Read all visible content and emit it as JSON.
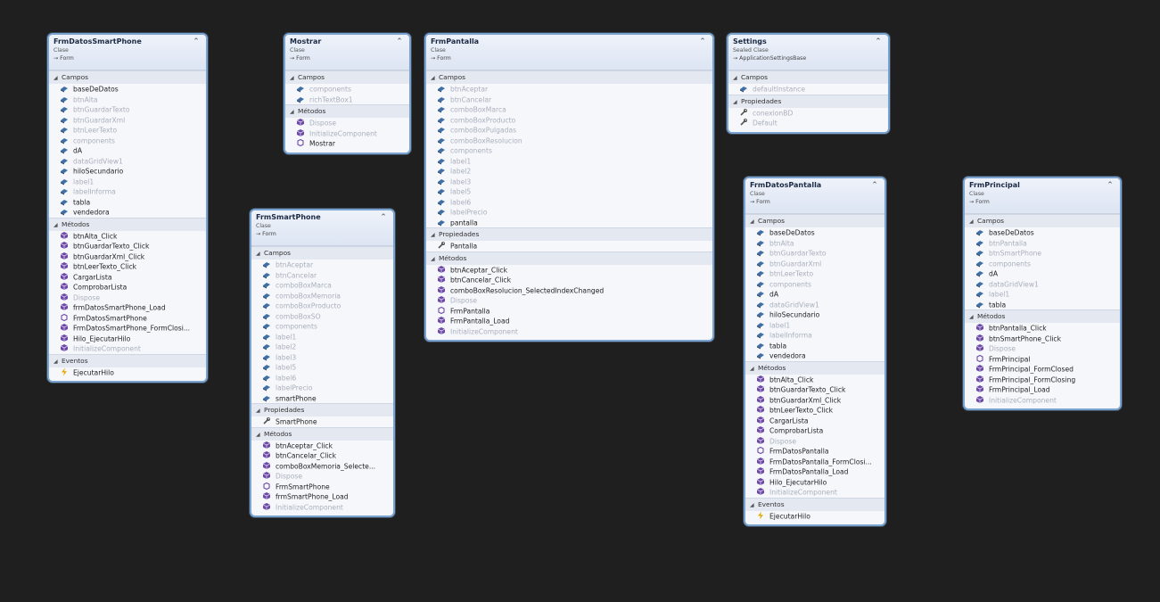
{
  "colors": {
    "background": "#1f1f1f",
    "field_icon": "#3f6fa5",
    "method_icon": "#6d4aa8",
    "property_icon": "#555555",
    "event_icon": "#e0a800",
    "dim_text": "#a8afbc"
  },
  "classes": [
    {
      "id": "FrmDatosSmartPhone",
      "name": "FrmDatosSmartPhone",
      "stereotype": "Clase",
      "inherits": "Form",
      "sections": [
        {
          "title": "Campos",
          "members": [
            {
              "label": "baseDeDatos",
              "icon": "field-icon",
              "dim": false
            },
            {
              "label": "btnAlta",
              "icon": "field-icon",
              "dim": true
            },
            {
              "label": "btnGuardarTexto",
              "icon": "field-icon",
              "dim": true
            },
            {
              "label": "btnGuardarXml",
              "icon": "field-icon",
              "dim": true
            },
            {
              "label": "btnLeerTexto",
              "icon": "field-icon",
              "dim": true
            },
            {
              "label": "components",
              "icon": "field-icon",
              "dim": true
            },
            {
              "label": "dA",
              "icon": "field-icon",
              "dim": false
            },
            {
              "label": "dataGridView1",
              "icon": "field-icon",
              "dim": true
            },
            {
              "label": "hiloSecundario",
              "icon": "field-icon",
              "dim": false
            },
            {
              "label": "label1",
              "icon": "field-icon",
              "dim": true
            },
            {
              "label": "labelInforma",
              "icon": "field-icon",
              "dim": true
            },
            {
              "label": "tabla",
              "icon": "field-icon",
              "dim": false
            },
            {
              "label": "vendedora",
              "icon": "field-icon",
              "dim": false
            }
          ]
        },
        {
          "title": "Métodos",
          "members": [
            {
              "label": "btnAlta_Click",
              "icon": "method-icon",
              "dim": false
            },
            {
              "label": "btnGuardarTexto_Click",
              "icon": "method-icon",
              "dim": false
            },
            {
              "label": "btnGuardarXml_Click",
              "icon": "method-icon",
              "dim": false
            },
            {
              "label": "btnLeerTexto_Click",
              "icon": "method-icon",
              "dim": false
            },
            {
              "label": "CargarLista",
              "icon": "method-icon",
              "dim": false
            },
            {
              "label": "ComprobarLista",
              "icon": "method-icon",
              "dim": false
            },
            {
              "label": "Dispose",
              "icon": "method-icon",
              "dim": true
            },
            {
              "label": "frmDatosSmartPhone_Load",
              "icon": "method-icon",
              "dim": false
            },
            {
              "label": "FrmDatosSmartPhone",
              "icon": "constructor-icon",
              "dim": false
            },
            {
              "label": "FrmDatosSmartPhone_FormClosi...",
              "icon": "method-icon",
              "dim": false
            },
            {
              "label": "Hilo_EjecutarHilo",
              "icon": "method-icon",
              "dim": false
            },
            {
              "label": "InitializeComponent",
              "icon": "method-icon",
              "dim": true
            }
          ]
        },
        {
          "title": "Eventos",
          "members": [
            {
              "label": "EjecutarHilo",
              "icon": "event-icon",
              "dim": false
            }
          ]
        }
      ]
    },
    {
      "id": "Mostrar",
      "name": "Mostrar",
      "stereotype": "Clase",
      "inherits": "Form",
      "sections": [
        {
          "title": "Campos",
          "members": [
            {
              "label": "components",
              "icon": "field-icon",
              "dim": true
            },
            {
              "label": "richTextBox1",
              "icon": "field-icon",
              "dim": true
            }
          ]
        },
        {
          "title": "Métodos",
          "members": [
            {
              "label": "Dispose",
              "icon": "method-icon",
              "dim": true
            },
            {
              "label": "InitializeComponent",
              "icon": "method-icon",
              "dim": true
            },
            {
              "label": "Mostrar",
              "icon": "constructor-icon",
              "dim": false
            }
          ]
        }
      ]
    },
    {
      "id": "FrmSmartPhone",
      "name": "FrmSmartPhone",
      "stereotype": "Clase",
      "inherits": "Form",
      "sections": [
        {
          "title": "Campos",
          "members": [
            {
              "label": "btnAceptar",
              "icon": "field-icon",
              "dim": true
            },
            {
              "label": "btnCancelar",
              "icon": "field-icon",
              "dim": true
            },
            {
              "label": "comboBoxMarca",
              "icon": "field-icon",
              "dim": true
            },
            {
              "label": "comboBoxMemoria",
              "icon": "field-icon",
              "dim": true
            },
            {
              "label": "comboBoxProducto",
              "icon": "field-icon",
              "dim": true
            },
            {
              "label": "comboBoxSO",
              "icon": "field-icon",
              "dim": true
            },
            {
              "label": "components",
              "icon": "field-icon",
              "dim": true
            },
            {
              "label": "label1",
              "icon": "field-icon",
              "dim": true
            },
            {
              "label": "label2",
              "icon": "field-icon",
              "dim": true
            },
            {
              "label": "label3",
              "icon": "field-icon",
              "dim": true
            },
            {
              "label": "label5",
              "icon": "field-icon",
              "dim": true
            },
            {
              "label": "label6",
              "icon": "field-icon",
              "dim": true
            },
            {
              "label": "labelPrecio",
              "icon": "field-icon",
              "dim": true
            },
            {
              "label": "smartPhone",
              "icon": "field-icon",
              "dim": false
            }
          ]
        },
        {
          "title": "Propiedades",
          "members": [
            {
              "label": "SmartPhone",
              "icon": "property-icon",
              "dim": false
            }
          ]
        },
        {
          "title": "Métodos",
          "members": [
            {
              "label": "btnAceptar_Click",
              "icon": "method-icon",
              "dim": false
            },
            {
              "label": "btnCancelar_Click",
              "icon": "method-icon",
              "dim": false
            },
            {
              "label": "comboBoxMemoria_Selecte...",
              "icon": "method-icon",
              "dim": false
            },
            {
              "label": "Dispose",
              "icon": "method-icon",
              "dim": true
            },
            {
              "label": "FrmSmartPhone",
              "icon": "constructor-icon",
              "dim": false
            },
            {
              "label": "frmSmartPhone_Load",
              "icon": "method-icon",
              "dim": false
            },
            {
              "label": "InitializeComponent",
              "icon": "method-icon",
              "dim": true
            }
          ]
        }
      ]
    },
    {
      "id": "FrmPantalla",
      "name": "FrmPantalla",
      "stereotype": "Clase",
      "inherits": "Form",
      "sections": [
        {
          "title": "Campos",
          "members": [
            {
              "label": "btnAceptar",
              "icon": "field-icon",
              "dim": true
            },
            {
              "label": "btnCancelar",
              "icon": "field-icon",
              "dim": true
            },
            {
              "label": "comboBoxMarca",
              "icon": "field-icon",
              "dim": true
            },
            {
              "label": "comboBoxProducto",
              "icon": "field-icon",
              "dim": true
            },
            {
              "label": "comboBoxPulgadas",
              "icon": "field-icon",
              "dim": true
            },
            {
              "label": "comboBoxResolucion",
              "icon": "field-icon",
              "dim": true
            },
            {
              "label": "components",
              "icon": "field-icon",
              "dim": true
            },
            {
              "label": "label1",
              "icon": "field-icon",
              "dim": true
            },
            {
              "label": "label2",
              "icon": "field-icon",
              "dim": true
            },
            {
              "label": "label3",
              "icon": "field-icon",
              "dim": true
            },
            {
              "label": "label5",
              "icon": "field-icon",
              "dim": true
            },
            {
              "label": "label6",
              "icon": "field-icon",
              "dim": true
            },
            {
              "label": "labelPrecio",
              "icon": "field-icon",
              "dim": true
            },
            {
              "label": "pantalla",
              "icon": "field-icon",
              "dim": false
            }
          ]
        },
        {
          "title": "Propiedades",
          "members": [
            {
              "label": "Pantalla",
              "icon": "property-icon",
              "dim": false
            }
          ]
        },
        {
          "title": "Métodos",
          "members": [
            {
              "label": "btnAceptar_Click",
              "icon": "method-icon",
              "dim": false
            },
            {
              "label": "btnCancelar_Click",
              "icon": "method-icon",
              "dim": false
            },
            {
              "label": "comboBoxResolucion_SelectedIndexChanged",
              "icon": "method-icon",
              "dim": false
            },
            {
              "label": "Dispose",
              "icon": "method-icon",
              "dim": true
            },
            {
              "label": "FrmPantalla",
              "icon": "constructor-icon",
              "dim": false
            },
            {
              "label": "FrmPantalla_Load",
              "icon": "method-icon",
              "dim": false
            },
            {
              "label": "InitializeComponent",
              "icon": "method-icon",
              "dim": true
            }
          ]
        }
      ]
    },
    {
      "id": "Settings",
      "name": "Settings",
      "stereotype": "Sealed Clase",
      "inherits": "ApplicationSettingsBase",
      "sections": [
        {
          "title": "Campos",
          "members": [
            {
              "label": "defaultInstance",
              "icon": "field-icon",
              "dim": true
            }
          ]
        },
        {
          "title": "Propiedades",
          "members": [
            {
              "label": "conexionBD",
              "icon": "property-icon",
              "dim": true
            },
            {
              "label": "Default",
              "icon": "property-icon",
              "dim": true
            }
          ]
        }
      ]
    },
    {
      "id": "FrmDatosPantalla",
      "name": "FrmDatosPantalla",
      "stereotype": "Clase",
      "inherits": "Form",
      "sections": [
        {
          "title": "Campos",
          "members": [
            {
              "label": "baseDeDatos",
              "icon": "field-icon",
              "dim": false
            },
            {
              "label": "btnAlta",
              "icon": "field-icon",
              "dim": true
            },
            {
              "label": "btnGuardarTexto",
              "icon": "field-icon",
              "dim": true
            },
            {
              "label": "btnGuardarXml",
              "icon": "field-icon",
              "dim": true
            },
            {
              "label": "btnLeerTexto",
              "icon": "field-icon",
              "dim": true
            },
            {
              "label": "components",
              "icon": "field-icon",
              "dim": true
            },
            {
              "label": "dA",
              "icon": "field-icon",
              "dim": false
            },
            {
              "label": "dataGridView1",
              "icon": "field-icon",
              "dim": true
            },
            {
              "label": "hiloSecundario",
              "icon": "field-icon",
              "dim": false
            },
            {
              "label": "label1",
              "icon": "field-icon",
              "dim": true
            },
            {
              "label": "labelInforma",
              "icon": "field-icon",
              "dim": true
            },
            {
              "label": "tabla",
              "icon": "field-icon",
              "dim": false
            },
            {
              "label": "vendedora",
              "icon": "field-icon",
              "dim": false
            }
          ]
        },
        {
          "title": "Métodos",
          "members": [
            {
              "label": "btnAlta_Click",
              "icon": "method-icon",
              "dim": false
            },
            {
              "label": "btnGuardarTexto_Click",
              "icon": "method-icon",
              "dim": false
            },
            {
              "label": "btnGuardarXml_Click",
              "icon": "method-icon",
              "dim": false
            },
            {
              "label": "btnLeerTexto_Click",
              "icon": "method-icon",
              "dim": false
            },
            {
              "label": "CargarLista",
              "icon": "method-icon",
              "dim": false
            },
            {
              "label": "ComprobarLista",
              "icon": "method-icon",
              "dim": false
            },
            {
              "label": "Dispose",
              "icon": "method-icon",
              "dim": true
            },
            {
              "label": "FrmDatosPantalla",
              "icon": "constructor-icon",
              "dim": false
            },
            {
              "label": "FrmDatosPantalla_FormClosi...",
              "icon": "method-icon",
              "dim": false
            },
            {
              "label": "FrmDatosPantalla_Load",
              "icon": "method-icon",
              "dim": false
            },
            {
              "label": "Hilo_EjecutarHilo",
              "icon": "method-icon",
              "dim": false
            },
            {
              "label": "InitializeComponent",
              "icon": "method-icon",
              "dim": true
            }
          ]
        },
        {
          "title": "Eventos",
          "members": [
            {
              "label": "EjecutarHilo",
              "icon": "event-icon",
              "dim": false
            }
          ]
        }
      ]
    },
    {
      "id": "FrmPrincipal",
      "name": "FrmPrincipal",
      "stereotype": "Clase",
      "inherits": "Form",
      "sections": [
        {
          "title": "Campos",
          "members": [
            {
              "label": "baseDeDatos",
              "icon": "field-icon",
              "dim": false
            },
            {
              "label": "btnPantalla",
              "icon": "field-icon",
              "dim": true
            },
            {
              "label": "btnSmartPhone",
              "icon": "field-icon",
              "dim": true
            },
            {
              "label": "components",
              "icon": "field-icon",
              "dim": true
            },
            {
              "label": "dA",
              "icon": "field-icon",
              "dim": false
            },
            {
              "label": "dataGridView1",
              "icon": "field-icon",
              "dim": true
            },
            {
              "label": "label1",
              "icon": "field-icon",
              "dim": true
            },
            {
              "label": "tabla",
              "icon": "field-icon",
              "dim": false
            }
          ]
        },
        {
          "title": "Métodos",
          "members": [
            {
              "label": "btnPantalla_Click",
              "icon": "method-icon",
              "dim": false
            },
            {
              "label": "btnSmartPhone_Click",
              "icon": "method-icon",
              "dim": false
            },
            {
              "label": "Dispose",
              "icon": "method-icon",
              "dim": true
            },
            {
              "label": "FrmPrincipal",
              "icon": "constructor-icon",
              "dim": false
            },
            {
              "label": "FrmPrincipal_FormClosed",
              "icon": "method-icon",
              "dim": false
            },
            {
              "label": "FrmPrincipal_FormClosing",
              "icon": "method-icon",
              "dim": false
            },
            {
              "label": "FrmPrincipal_Load",
              "icon": "method-icon",
              "dim": false
            },
            {
              "label": "InitializeComponent",
              "icon": "method-icon",
              "dim": true
            }
          ]
        }
      ]
    }
  ]
}
